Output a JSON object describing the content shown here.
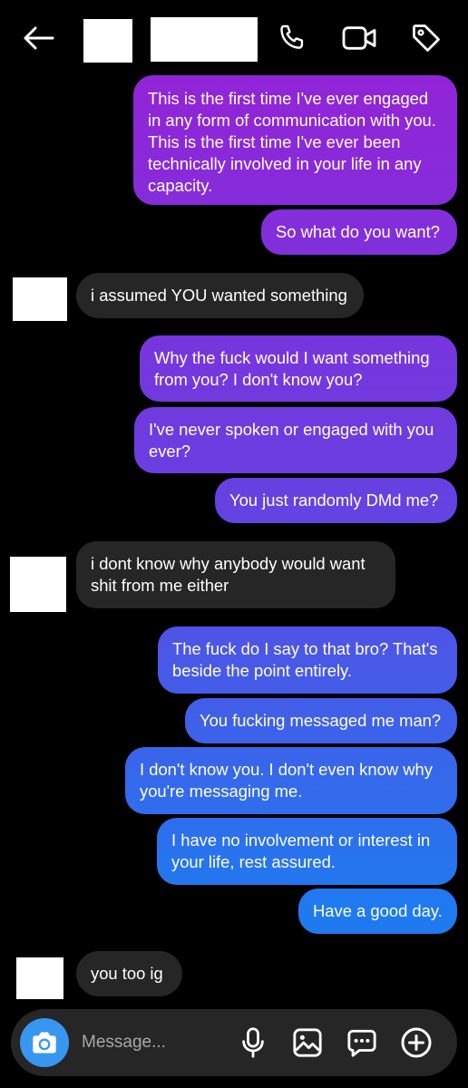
{
  "header": {
    "back_icon": "arrow-left-icon",
    "call_icon": "phone-icon",
    "video_icon": "video-camera-icon",
    "tag_icon": "tag-icon"
  },
  "messages": [
    {
      "sender": "me",
      "text": "This is the first time I've ever engaged in any form of communication with you. This is the first time I've ever been technically involved in your life in any capacity."
    },
    {
      "sender": "me",
      "text": "So what do you want?"
    },
    {
      "sender": "them",
      "text": "i assumed YOU wanted something"
    },
    {
      "sender": "me",
      "text": "Why the fuck would I want something from you? I don't know you?"
    },
    {
      "sender": "me",
      "text": "I've never spoken or engaged with you ever?"
    },
    {
      "sender": "me",
      "text": "You just randomly DMd me?"
    },
    {
      "sender": "them",
      "text": "i dont know why anybody would want shit from me either"
    },
    {
      "sender": "me",
      "text": "The fuck do I say to that bro? That's beside the point entirely."
    },
    {
      "sender": "me",
      "text": "You fucking messaged me man?"
    },
    {
      "sender": "me",
      "text": "I don't know you. I don't even know why you're messaging me."
    },
    {
      "sender": "me",
      "text": "I have no involvement or interest in your life, rest assured."
    },
    {
      "sender": "me",
      "text": "Have a good day."
    },
    {
      "sender": "them",
      "text": "you too ig"
    }
  ],
  "composer": {
    "placeholder": "Message...",
    "camera_icon": "camera-icon",
    "mic_icon": "microphone-icon",
    "gallery_icon": "image-icon",
    "sticker_icon": "chat-bubble-icon",
    "add_icon": "plus-circle-icon"
  },
  "colors": {
    "background": "#000000",
    "received_bubble": "#262626",
    "sent_gradient_top": "#9a1fd6",
    "sent_gradient_mid": "#6a3ee0",
    "sent_gradient_bottom": "#1f7af0",
    "camera_button": "#3797f0",
    "placeholder_text": "#a8a8a8"
  }
}
